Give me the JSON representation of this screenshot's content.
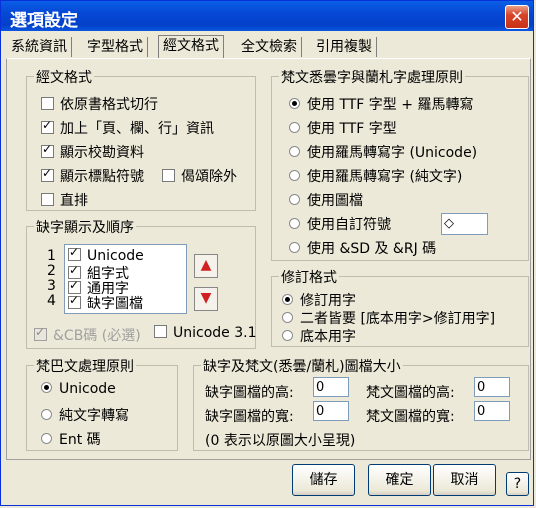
{
  "window": {
    "title": "選項設定",
    "close": "✕"
  },
  "tabs": [
    "系統資訊",
    "字型格式",
    "經文格式",
    "全文檢索",
    "引用複製"
  ],
  "sutra_format": {
    "legend": "經文格式",
    "items": [
      {
        "label": "依原書格式切行",
        "checked": false
      },
      {
        "label": "加上「頁、欄、行」資訊",
        "checked": true
      },
      {
        "label": "顯示校勘資料",
        "checked": true
      },
      {
        "label": "顯示標點符號",
        "checked": true
      },
      {
        "label": "偈頌除外",
        "checked": false
      },
      {
        "label": "直排",
        "checked": false
      }
    ]
  },
  "missing_chars": {
    "legend": "缺字顯示及順序",
    "numbers": [
      "1",
      "2",
      "3",
      "4"
    ],
    "items": [
      {
        "label": "Unicode",
        "checked": true
      },
      {
        "label": "組字式",
        "checked": true
      },
      {
        "label": "通用字",
        "checked": true
      },
      {
        "label": "缺字圖檔",
        "checked": true
      }
    ],
    "cb_code": "&CB碼 (必選)",
    "unicode31": "Unicode 3.1"
  },
  "sanskrit_rules": {
    "legend": "梵文悉曇字與蘭札字處理原則",
    "options": [
      {
        "label": "使用 TTF 字型 + 羅馬轉寫",
        "selected": true
      },
      {
        "label": "使用 TTF 字型",
        "selected": false
      },
      {
        "label": "使用羅馬轉寫字 (Unicode)",
        "selected": false
      },
      {
        "label": "使用羅馬轉寫字 (純文字)",
        "selected": false
      },
      {
        "label": "使用圖檔",
        "selected": false
      },
      {
        "label": "使用自訂符號",
        "selected": false
      },
      {
        "label": "使用 &SD 及 &RJ 碼",
        "selected": false
      }
    ],
    "custom_symbol": "◇"
  },
  "revision_format": {
    "legend": "修訂格式",
    "options": [
      {
        "label": "修訂用字",
        "selected": true
      },
      {
        "label": "二者皆要 [底本用字>修訂用字]",
        "selected": false
      },
      {
        "label": "底本用字",
        "selected": false
      }
    ]
  },
  "pali_rules": {
    "legend": "梵巴文處理原則",
    "options": [
      {
        "label": "Unicode",
        "selected": true
      },
      {
        "label": "純文字轉寫",
        "selected": false
      },
      {
        "label": "Ent 碼",
        "selected": false
      }
    ]
  },
  "image_size": {
    "legend": "缺字及梵文(悉曇/蘭札)圖檔大小",
    "missing_height_label": "缺字圖檔的高:",
    "missing_height": "0",
    "sanskrit_height_label": "梵文圖檔的高:",
    "sanskrit_height": "0",
    "missing_width_label": "缺字圖檔的寬:",
    "missing_width": "0",
    "sanskrit_width_label": "梵文圖檔的寬:",
    "sanskrit_width": "0",
    "note": "(0 表示以原圖大小呈現)"
  },
  "buttons": {
    "save": "儲存",
    "ok": "確定",
    "cancel": "取消",
    "help": "?"
  }
}
